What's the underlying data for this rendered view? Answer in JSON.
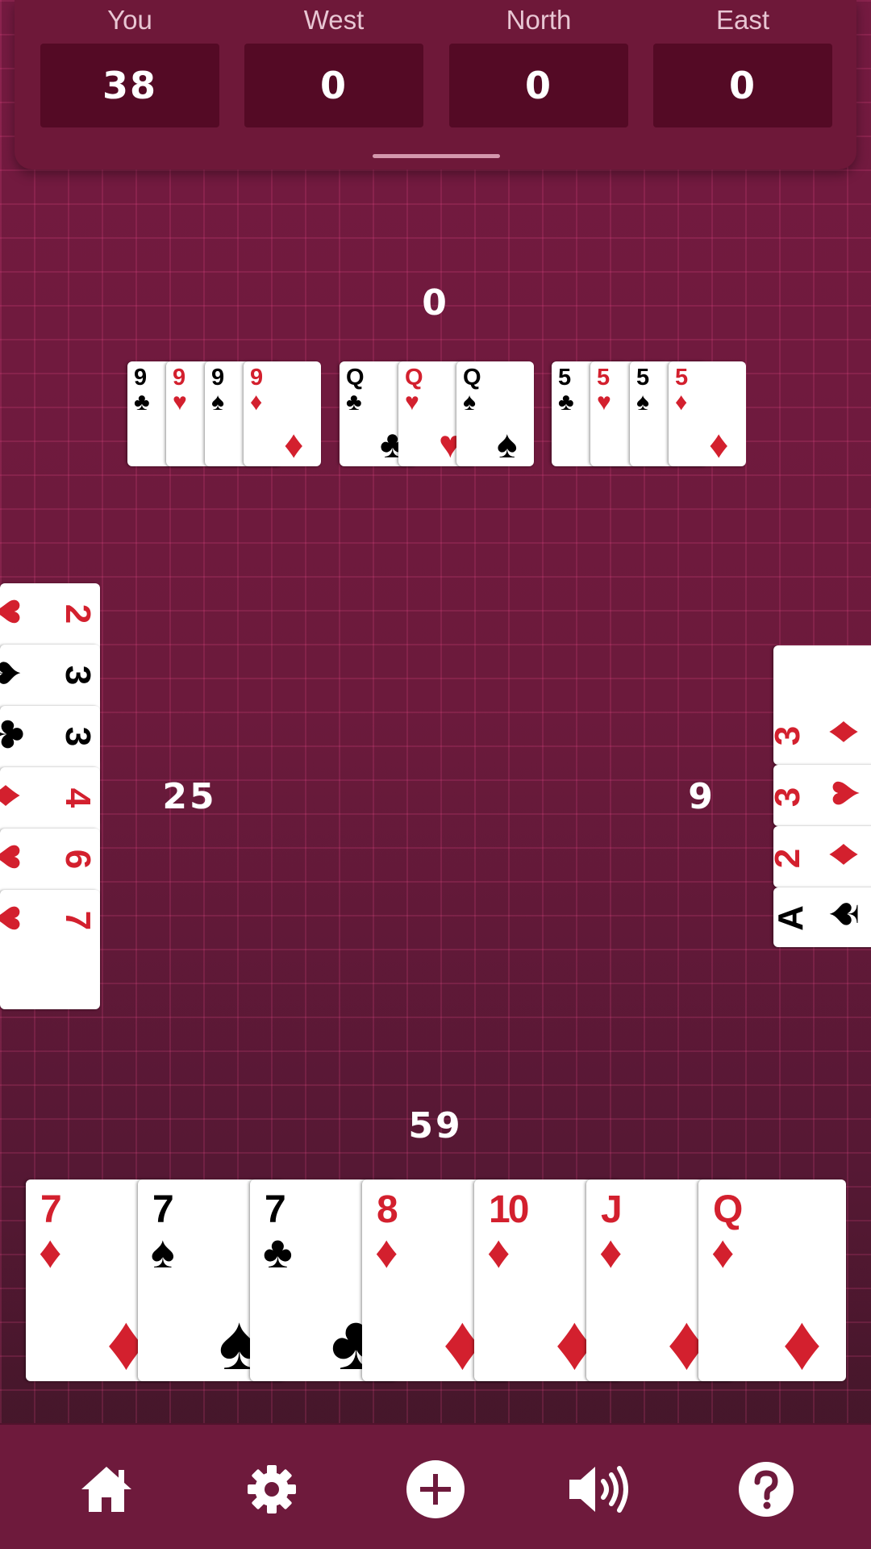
{
  "scoreboard": {
    "players": [
      {
        "name": "You",
        "score": "38"
      },
      {
        "name": "West",
        "score": "0"
      },
      {
        "name": "North",
        "score": "0"
      },
      {
        "name": "East",
        "score": "0"
      }
    ]
  },
  "counts": {
    "north": "0",
    "west": "25",
    "east": "9",
    "south": "59"
  },
  "north_melds": [
    {
      "rank": "9",
      "suit": "♣",
      "color": "black"
    },
    {
      "rank": "9",
      "suit": "♥",
      "color": "red"
    },
    {
      "rank": "9",
      "suit": "♠",
      "color": "black"
    },
    {
      "rank": "9",
      "suit": "♦",
      "color": "red"
    },
    {
      "rank": "Q",
      "suit": "♣",
      "color": "black"
    },
    {
      "rank": "Q",
      "suit": "♥",
      "color": "red"
    },
    {
      "rank": "Q",
      "suit": "♠",
      "color": "black"
    },
    {
      "rank": "5",
      "suit": "♣",
      "color": "black"
    },
    {
      "rank": "5",
      "suit": "♥",
      "color": "red"
    },
    {
      "rank": "5",
      "suit": "♠",
      "color": "black"
    },
    {
      "rank": "5",
      "suit": "♦",
      "color": "red"
    }
  ],
  "west_cards": [
    {
      "rank": "2",
      "suit": "♥",
      "color": "red"
    },
    {
      "rank": "3",
      "suit": "♠",
      "color": "black"
    },
    {
      "rank": "3",
      "suit": "♣",
      "color": "black"
    },
    {
      "rank": "4",
      "suit": "♦",
      "color": "red"
    },
    {
      "rank": "6",
      "suit": "♥",
      "color": "red"
    },
    {
      "rank": "7",
      "suit": "♥",
      "color": "red"
    }
  ],
  "east_cards": [
    {
      "rank": "3",
      "suit": "♦",
      "color": "red"
    },
    {
      "rank": "3",
      "suit": "♥",
      "color": "red"
    },
    {
      "rank": "2",
      "suit": "♦",
      "color": "red"
    },
    {
      "rank": "A",
      "suit": "♠",
      "color": "black"
    }
  ],
  "hand": [
    {
      "rank": "7",
      "suit": "♦",
      "color": "red"
    },
    {
      "rank": "7",
      "suit": "♠",
      "color": "black"
    },
    {
      "rank": "7",
      "suit": "♣",
      "color": "black"
    },
    {
      "rank": "8",
      "suit": "♦",
      "color": "red"
    },
    {
      "rank": "10",
      "suit": "♦",
      "color": "red"
    },
    {
      "rank": "J",
      "suit": "♦",
      "color": "red"
    },
    {
      "rank": "Q",
      "suit": "♦",
      "color": "red"
    }
  ],
  "toolbar": {
    "icons": [
      "home-icon",
      "gear-icon",
      "plus-icon",
      "volume-icon",
      "help-icon"
    ]
  },
  "colors": {
    "background": "#6a1839",
    "scorebox": "#540a25",
    "red_suit": "#d3202e"
  }
}
